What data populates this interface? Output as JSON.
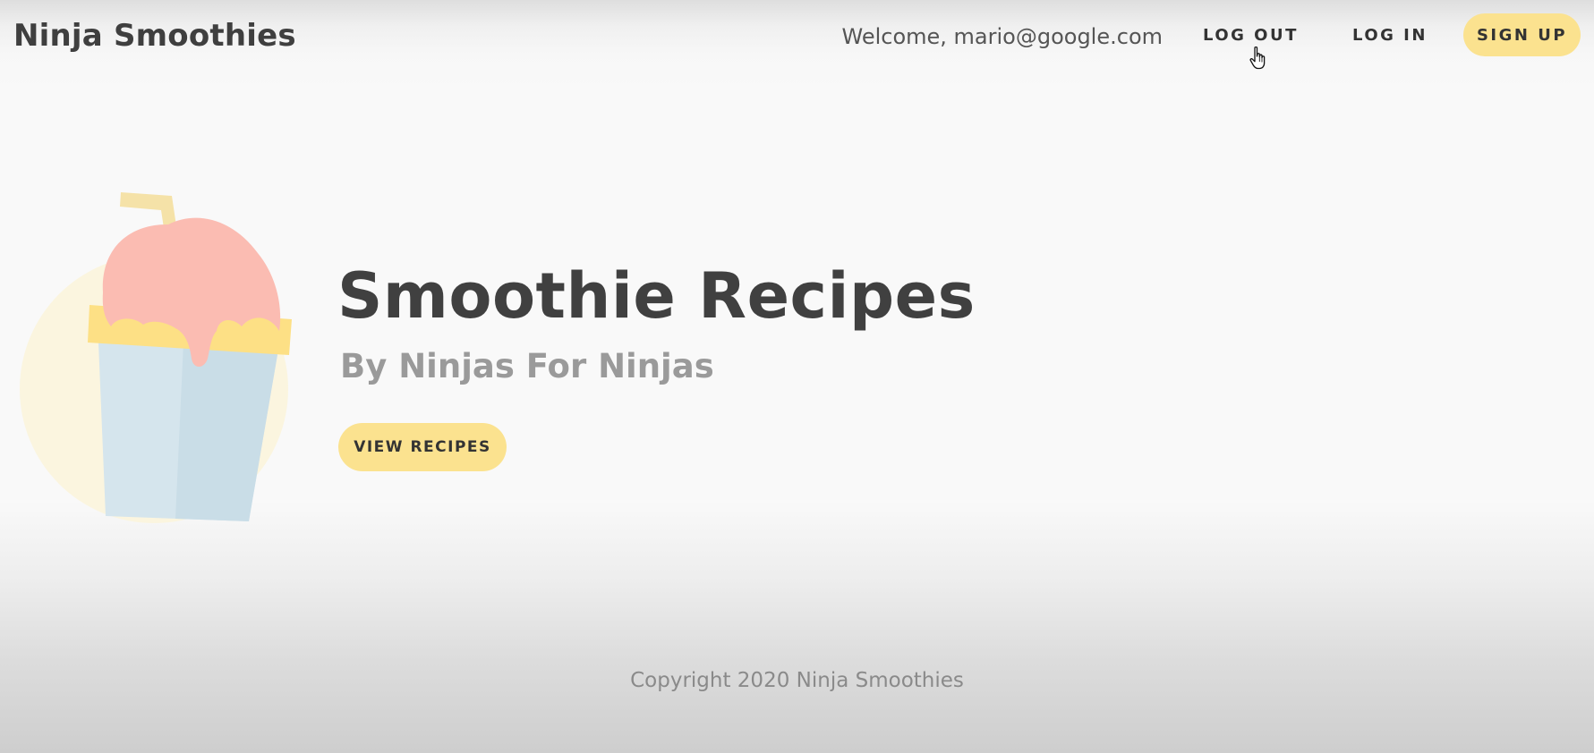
{
  "nav": {
    "brand": "Ninja Smoothies",
    "welcome": "Welcome, mario@google.com",
    "logout_label": "LOG OUT",
    "login_label": "LOG IN",
    "signup_label": "SIGN UP"
  },
  "hero": {
    "title": "Smoothie Recipes",
    "subtitle": "By Ninjas For Ninjas",
    "button_label": "VIEW RECIPES",
    "image_icon": "smoothie-cup-icon"
  },
  "footer": {
    "copyright": "Copyright 2020 Ninja Smoothies"
  },
  "colors": {
    "accent": "#fbe28f",
    "smoothie_pink": "#fbbcb2",
    "cup_blue": "#d5e5ed",
    "cup_yellow": "#fde085",
    "straw": "#f5e2a8"
  },
  "cursor": "pointer-hand-icon"
}
